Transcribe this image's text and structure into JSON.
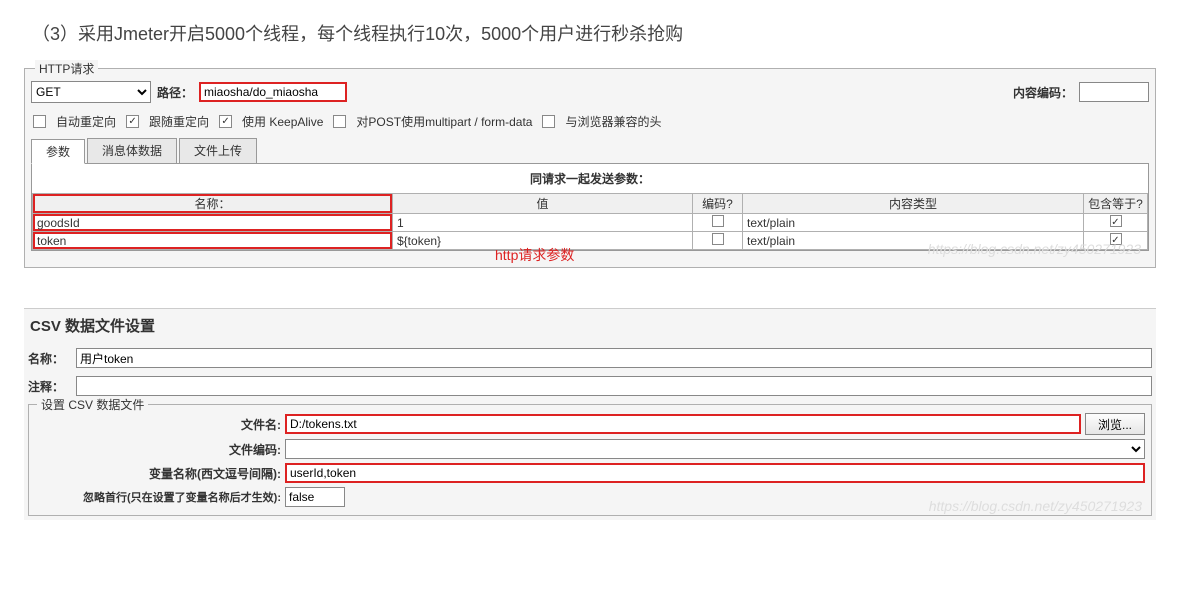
{
  "heading": "（3）采用Jmeter开启5000个线程，每个线程执行10次，5000个用户进行秒杀抢购",
  "http": {
    "panel_title": "HTTP请求",
    "method": "GET",
    "path_label": "路径：",
    "path_value": "miaosha/do_miaosha",
    "content_enc_label": "内容编码：",
    "content_enc_value": "",
    "checks": {
      "autoredirect": {
        "label": "自动重定向",
        "checked": false
      },
      "followredirect": {
        "label": "跟随重定向",
        "checked": true
      },
      "keepalive": {
        "label": "使用 KeepAlive",
        "checked": true
      },
      "multipart": {
        "label": "对POST使用multipart / form-data",
        "checked": false
      },
      "browserheaders": {
        "label": "与浏览器兼容的头",
        "checked": false
      }
    },
    "tabs": {
      "params": "参数",
      "body": "消息体数据",
      "upload": "文件上传"
    },
    "section_head": "同请求一起发送参数：",
    "columns": {
      "name": "名称：",
      "value": "值",
      "encode": "编码?",
      "ctype": "内容类型",
      "include": "包含等于?"
    },
    "rows": [
      {
        "name": "goodsId",
        "value": "1",
        "encode": false,
        "ctype": "text/plain",
        "include": true
      },
      {
        "name": "token",
        "value": "${token}",
        "encode": false,
        "ctype": "text/plain",
        "include": true
      }
    ],
    "annotation": "http请求参数",
    "watermark": "https://blog.csdn.net/zy450271923"
  },
  "csv": {
    "title": "CSV 数据文件设置",
    "name_label": "名称：",
    "name_value": "用户token",
    "comment_label": "注释：",
    "comment_value": "",
    "fieldset_title": "设置 CSV 数据文件",
    "filename_label": "文件名:",
    "filename_value": "D:/tokens.txt",
    "fileenc_label": "文件编码:",
    "fileenc_value": "",
    "varnames_label": "变量名称(西文逗号间隔):",
    "varnames_value": "userId,token",
    "lastrow_label": "忽略首行(只在设置了变量名称后才生效):",
    "lastrow_value": "false",
    "browse_label": "浏览...",
    "watermark": "https://blog.csdn.net/zy450271923"
  }
}
